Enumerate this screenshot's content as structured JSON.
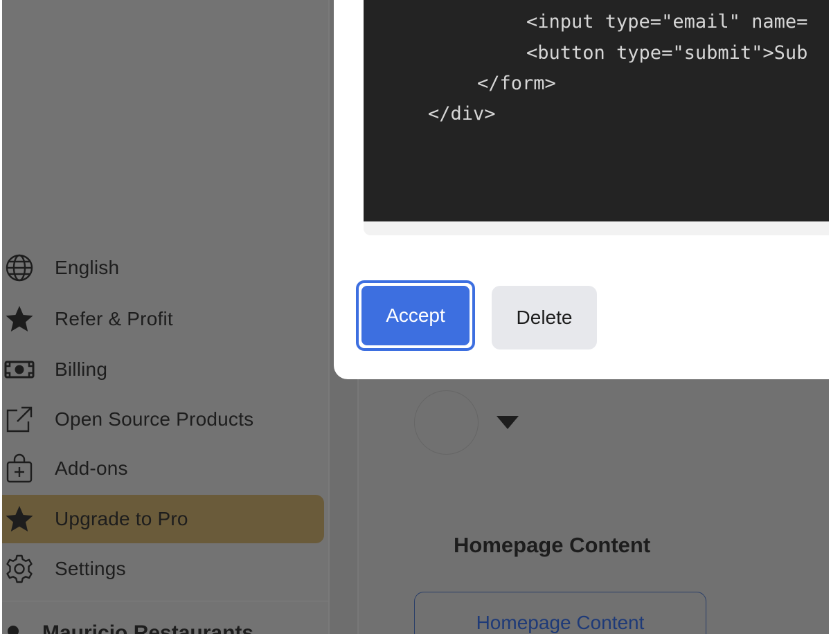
{
  "sidebar": {
    "items": [
      {
        "label": "English",
        "icon": "globe-icon"
      },
      {
        "label": "Refer & Profit",
        "icon": "star-icon"
      },
      {
        "label": "Billing",
        "icon": "cash-icon"
      },
      {
        "label": "Open Source Products",
        "icon": "external-link-icon"
      },
      {
        "label": "Add-ons",
        "icon": "shopping-bag-plus-icon"
      },
      {
        "label": "Upgrade to Pro",
        "icon": "star-icon",
        "active": true
      },
      {
        "label": "Settings",
        "icon": "gear-icon"
      }
    ],
    "workspace_name": "Mauricio Restaurants"
  },
  "main": {
    "section_title": "Homepage Content",
    "section_button": "Homepage Content"
  },
  "modal": {
    "code_lines": [
      "<input type=\"email\" name=",
      "<button type=\"submit\">Sub",
      "</form>",
      "</div>"
    ],
    "accept_label": "Accept",
    "delete_label": "Delete"
  },
  "colors": {
    "accent": "#3d6fe0",
    "active_nav": "#6a5b3a",
    "code_bg": "#232323"
  }
}
